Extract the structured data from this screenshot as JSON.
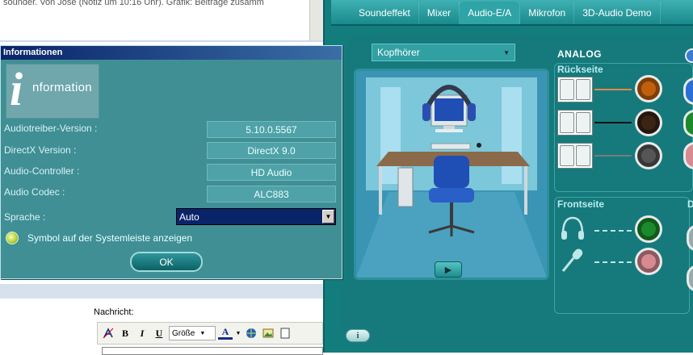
{
  "background_page": {
    "top_text": "sounder. Von Jose (Notiz um 10:16 Uhr). Grafik: Beiträge zusamm",
    "message_label": "Nachricht:",
    "toolbar": {
      "bold": "B",
      "italic": "I",
      "underline": "U",
      "size_select": "Größe",
      "font_color": "A"
    }
  },
  "realtek": {
    "tabs": [
      "Soundeffekt",
      "Mixer",
      "Audio-E/A",
      "Mikrofon",
      "3D-Audio Demo"
    ],
    "selected_tab": "Audio-E/A",
    "device_select": "Kopfhörer",
    "analog_title": "ANALOG",
    "rear_label": "Rückseite",
    "front_label": "Frontseite",
    "right_label": "D",
    "info_button": "i",
    "jack_colors": {
      "orange": "#c0600e",
      "black": "#3a2414",
      "grey": "#555555",
      "green": "#1b8a2b",
      "pink": "#d88a93",
      "blue": "#2a6fd6"
    }
  },
  "dialog": {
    "title": "Informationen",
    "logo_i": "i",
    "logo_text": "nformation",
    "rows": [
      {
        "label": "Audiotreiber-Version :",
        "value": "5.10.0.5567"
      },
      {
        "label": "DirectX Version :",
        "value": "DirectX 9.0"
      },
      {
        "label": "Audio-Controller :",
        "value": "HD Audio"
      },
      {
        "label": "Audio Codec :",
        "value": "ALC883"
      }
    ],
    "language_label": "Sprache :",
    "language_value": "Auto",
    "tray_option": "Symbol auf der Systemleiste anzeigen",
    "ok_button": "OK"
  }
}
